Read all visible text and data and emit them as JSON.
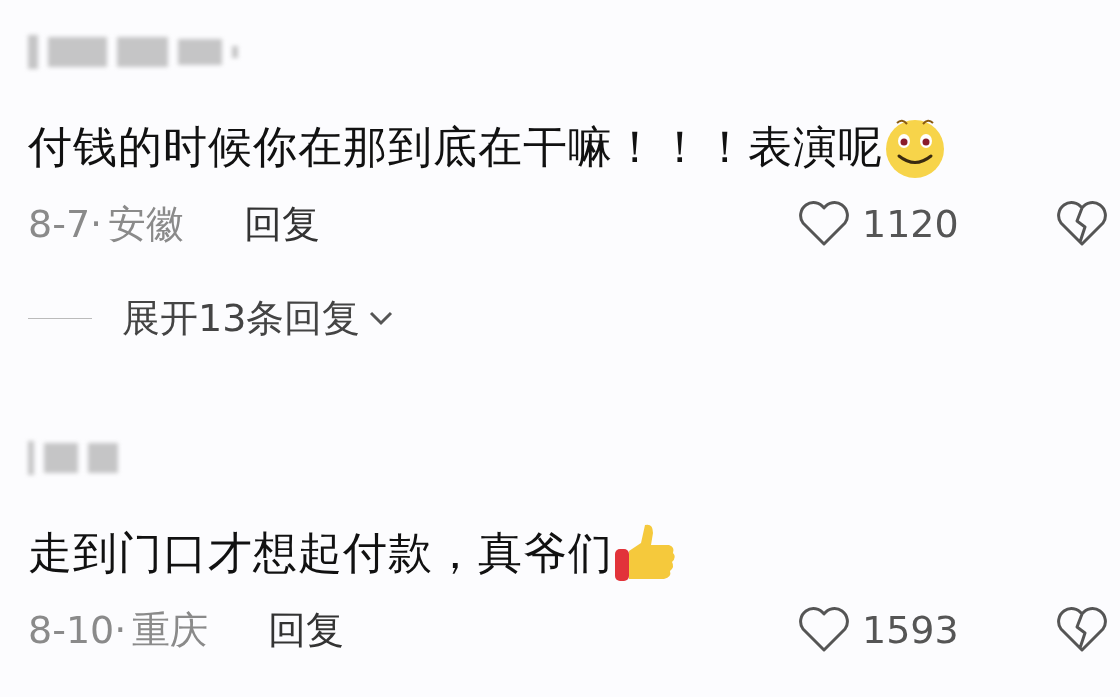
{
  "comments": [
    {
      "text": "付钱的时候你在那到底在干嘛！！！表演呢",
      "emoji": {
        "kind": "smile"
      },
      "date": "8-7·",
      "location": "安徽",
      "reply": "回复",
      "likes": "1120",
      "expand": "展开13条回复"
    },
    {
      "text": "走到门口才想起付款，真爷们",
      "emoji": {
        "kind": "thumbs"
      },
      "date": "8-10·",
      "location": "重庆",
      "reply": "回复",
      "likes": "1593"
    }
  ]
}
